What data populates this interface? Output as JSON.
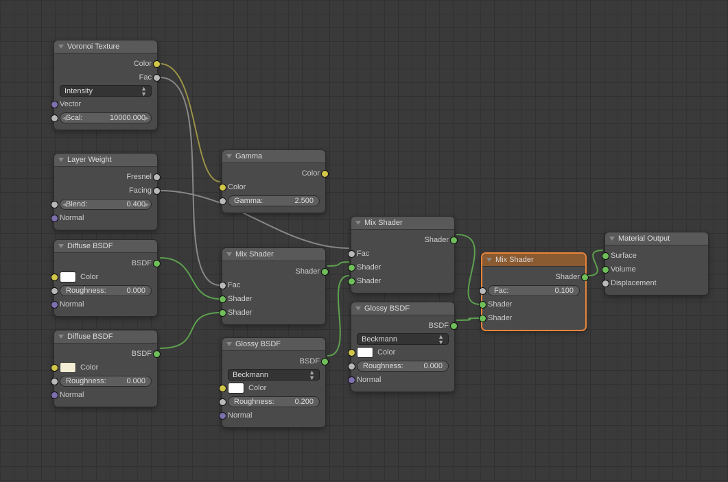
{
  "nodes": {
    "voronoi": {
      "title": "Voronoi Texture",
      "out_color": "Color",
      "out_fac": "Fac",
      "dropdown": "Intensity",
      "in_vector": "Vector",
      "scale_label": "Scal:",
      "scale_value": "10000.000"
    },
    "layerweight": {
      "title": "Layer Weight",
      "out_fresnel": "Fresnel",
      "out_facing": "Facing",
      "blend_label": "Blend:",
      "blend_value": "0.400",
      "in_normal": "Normal"
    },
    "diffuse1": {
      "title": "Diffuse BSDF",
      "out_bsdf": "BSDF",
      "color_label": "Color",
      "rough_label": "Roughness:",
      "rough_value": "0.000",
      "in_normal": "Normal"
    },
    "diffuse2": {
      "title": "Diffuse BSDF",
      "out_bsdf": "BSDF",
      "color_label": "Color",
      "rough_label": "Roughness:",
      "rough_value": "0.000",
      "in_normal": "Normal"
    },
    "gamma": {
      "title": "Gamma",
      "out_color": "Color",
      "in_color": "Color",
      "gamma_label": "Gamma:",
      "gamma_value": "2.500"
    },
    "mix1": {
      "title": "Mix Shader",
      "out_shader": "Shader",
      "in_fac": "Fac",
      "in_shader1": "Shader",
      "in_shader2": "Shader"
    },
    "glossy1": {
      "title": "Glossy BSDF",
      "out_bsdf": "BSDF",
      "dist": "Beckmann",
      "color_label": "Color",
      "rough_label": "Roughness:",
      "rough_value": "0.200",
      "in_normal": "Normal"
    },
    "mix2": {
      "title": "Mix Shader",
      "out_shader": "Shader",
      "in_fac": "Fac",
      "in_shader1": "Shader",
      "in_shader2": "Shader"
    },
    "glossy2": {
      "title": "Glossy BSDF",
      "out_bsdf": "BSDF",
      "dist": "Beckmann",
      "color_label": "Color",
      "rough_label": "Roughness:",
      "rough_value": "0.000",
      "in_normal": "Normal"
    },
    "mix3": {
      "title": "Mix Shader",
      "out_shader": "Shader",
      "fac_label": "Fac:",
      "fac_value": "0.100",
      "in_shader1": "Shader",
      "in_shader2": "Shader"
    },
    "output": {
      "title": "Material Output",
      "in_surface": "Surface",
      "in_volume": "Volume",
      "in_disp": "Displacement"
    }
  },
  "colors": {
    "diffuse1_swatch": "#ffffff",
    "diffuse2_swatch": "#f2efd6",
    "glossy1_swatch": "#ffffff",
    "glossy2_swatch": "#ffffff"
  }
}
